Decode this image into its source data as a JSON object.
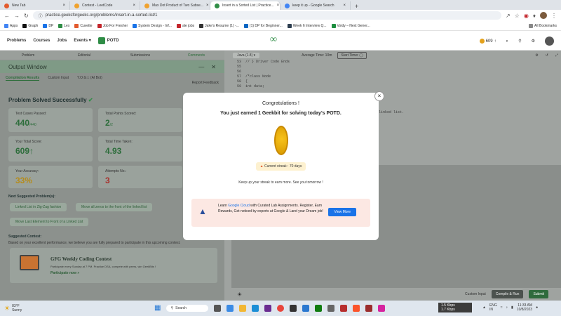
{
  "browser": {
    "tabs": [
      {
        "title": "New Tab",
        "color": "#e35b2e",
        "active": false
      },
      {
        "title": "Contest - LeetCode",
        "color": "#f0a22e",
        "active": false
      },
      {
        "title": "Max Dot Product of Two Subse...",
        "color": "#f0a22e",
        "active": false
      },
      {
        "title": "Insert in a Sorted List | Practice...",
        "color": "#2f8d46",
        "active": true
      },
      {
        "title": "keep it up - Google Search",
        "color": "#4285f4",
        "active": false
      }
    ],
    "url": "practice.geeksforgeeks.org/problems/insert-in-a-sorted-list/1",
    "bookmarks": [
      "Apps",
      "Graph",
      "DP",
      "Lex",
      "Cuvette",
      "Job For Fresher",
      "System Design - Inf...",
      "ale jobs",
      "Jake's Resume (1) -...",
      "(1) DP for Beginner...",
      "Week 6 Interview Q...",
      "Voidy – Next Gener..."
    ],
    "all_bookmarks": "All Bookmarks"
  },
  "site": {
    "nav": [
      "Problems",
      "Courses",
      "Jobs",
      "Events",
      "POTD"
    ],
    "logo": "GfG",
    "streak_count": "609"
  },
  "left": {
    "subnav": [
      "Problem",
      "Editorial",
      "Submissions",
      "Comments"
    ],
    "output_title": "Output Window",
    "out_tabs": [
      "Compilation Results",
      "Custom Input",
      "Y.O.G.I. (AI Bot)"
    ],
    "feedback": "Report Feedback",
    "solved": "Problem Solved Successfully",
    "stats": {
      "test_cases_label": "Test Cases Passed:",
      "test_cases_value": "440",
      "test_cases_total": "/440",
      "points_label": "Total Points Scored:",
      "points_value": "2",
      "points_total": "/2",
      "score_label": "Your Total Score:",
      "score_value": "609",
      "time_label": "Total Time Taken:",
      "time_value": "4.93",
      "accuracy_label": "Your Accuracy:",
      "accuracy_value": "33%",
      "attempts_label": "Attempts No.:",
      "attempts_value": "3"
    },
    "next_title": "Next Suggested Problem(s):",
    "next_problems": [
      "Linked List in Zig-Zag fashion",
      "Move all zeros to the front of the linked list",
      "Move Last Element to Front of a Linked List"
    ],
    "contest_title": "Suggested Contest:",
    "contest_desc": "Based on your excellent performance, we believe you are fully prepared to participate in this upcoming contest.",
    "contest_name": "GFG Weekly Coding Contest",
    "contest_sub": "Participate every Sunday at 7 PM. Practice DSA, compete with peers, win GeekBits !",
    "contest_link": "Participate now »"
  },
  "editor": {
    "lang": "Java (1.8)",
    "avg_time": "Average Time: 10m",
    "timer": "Start Timer",
    "lines": [
      "53",
      "55",
      "56",
      "57",
      "58",
      "59"
    ],
    "code": [
      "// } Driver Code Ends",
      "",
      "/*class Node",
      "    {",
      "        int data;",
      ""
    ],
    "code_tail": "linked list.",
    "custom_input": "Custom Input",
    "compile": "Compile & Run",
    "submit": "Submit"
  },
  "modal": {
    "title": "Congratulations !",
    "subtitle": "You just earned 1 Geekbit for solving today's POTD.",
    "streak": "Current streak : 70 days",
    "keep": "Keep up your streak to earn more. See you tomorrow !",
    "ad_text_1": "Learn ",
    "ad_brand": "Google Cloud",
    "ad_text_2": " with Curated Lab Assignments. Register, Earn Rewards, Get noticed by experts at Google & Land your Dream job!",
    "ad_button": "View More",
    "close": "×"
  },
  "taskbar": {
    "weather_temp": "83°F",
    "weather_desc": "Sunny",
    "search": "Search",
    "net_up": "1.5 Kbps",
    "net_down": "1.7 Kbps",
    "lang": "ENG",
    "region": "IN",
    "time": "11:33 AM",
    "date": "10/8/2023"
  }
}
